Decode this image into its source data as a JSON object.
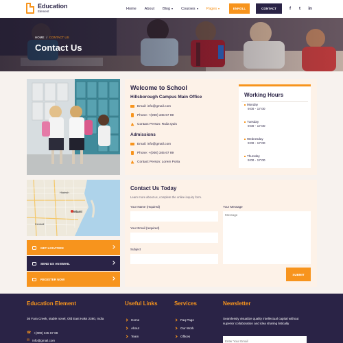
{
  "brand": {
    "title": "Education",
    "subtitle": "Element"
  },
  "nav": [
    {
      "label": "Home",
      "dropdown": false,
      "active": false
    },
    {
      "label": "About",
      "dropdown": false,
      "active": false
    },
    {
      "label": "Blog",
      "dropdown": true,
      "active": false
    },
    {
      "label": "Courses",
      "dropdown": true,
      "active": false
    },
    {
      "label": "Pages",
      "dropdown": true,
      "active": true
    }
  ],
  "header_buttons": {
    "enroll": "ENROLL",
    "contact": "CONTACT"
  },
  "social": [
    {
      "icon": "facebook-icon",
      "glyph": "f"
    },
    {
      "icon": "twitter-icon",
      "glyph": "t"
    },
    {
      "icon": "linkedin-icon",
      "glyph": "in"
    }
  ],
  "hero": {
    "breadcrumb_home": "HOME",
    "breadcrumb_sep": "/",
    "breadcrumb_current": "CONTACT US",
    "title": "Contact Us"
  },
  "welcome": {
    "title": "Welcome to School",
    "campus_title": "Hillsborough Campus Main Office",
    "campus_email": "Email: info@gmail.com",
    "campus_phone": "Phone: +(000) 345 67 89",
    "campus_person": "Contact Person: Ruiia Quis",
    "admissions_title": "Admissions",
    "adm_email": "Email: info@gmail.com",
    "adm_phone": "Phone: +(000) 345 67 89",
    "adm_person": "Contact Person: Lorem Porta"
  },
  "hours": {
    "title": "Working Hours",
    "days": [
      {
        "day": "Monday",
        "time": "9:00 - 17:00"
      },
      {
        "day": "Tuesday",
        "time": "9:00 - 17:00"
      },
      {
        "day": "Wednesday",
        "time": "9:00 - 17:00"
      },
      {
        "day": "Thursday",
        "time": "9:00 - 17:00"
      }
    ]
  },
  "map": {
    "labels": [
      "Hialeah",
      "Miami",
      "Kendall"
    ]
  },
  "actions": {
    "location": "GET LOCATION",
    "email": "SEND US AN EMAIL",
    "register": "REGISTER NOW"
  },
  "form": {
    "title": "Contact Us Today",
    "subtitle": "Learn more about us, complete the online inquiry form.",
    "name_label": "Your Name (required)",
    "email_label": "Your Email (required)",
    "subject_label": "Subject",
    "message_label": "Your Message",
    "message_placeholder": "Message",
    "submit": "SUBMIT"
  },
  "footer": {
    "col1_title": "Education Element",
    "address": "36 Fara Creek, stable novel, Old East Haks 2360, India",
    "phone": "+(000) 345 67 89",
    "email": "info@gmail.com",
    "col2_title": "Useful Links",
    "links": [
      "Home",
      "About",
      "Team"
    ],
    "col3_title": "Services",
    "services": [
      "Faq Page",
      "Our Work",
      "Offices"
    ],
    "col4_title": "Newsletter",
    "newsletter_text": "Seamlessly visualize quality intellectual capital without superior collaboration and idea sharing listically",
    "newsletter_placeholder": "Enter Your Email"
  },
  "colors": {
    "accent": "#f7941d",
    "navy": "#2a2346",
    "cream": "#fdf2e8",
    "section_bg": "#f7f2ee"
  }
}
